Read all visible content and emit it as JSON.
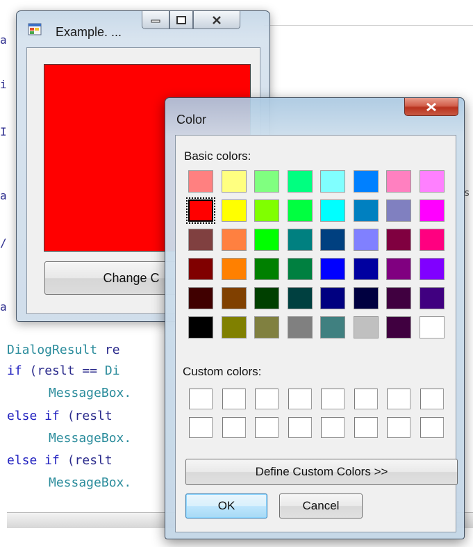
{
  "background_editor": {
    "code_lines": [
      {
        "parts": [
          {
            "t": "DialogResult ",
            "c": "type"
          },
          {
            "t": "re",
            "c": ""
          }
        ]
      },
      {
        "parts": [
          {
            "t": "if",
            "c": "kw"
          },
          {
            "t": " (reslt == ",
            "c": ""
          },
          {
            "t": "Di",
            "c": "type"
          }
        ]
      },
      {
        "indent": true,
        "parts": [
          {
            "t": "MessageBox.",
            "c": "type"
          }
        ]
      },
      {
        "parts": [
          {
            "t": "else if",
            "c": "kw"
          },
          {
            "t": " (reslt",
            "c": ""
          }
        ]
      },
      {
        "indent": true,
        "parts": [
          {
            "t": "MessageBox.",
            "c": "type"
          }
        ]
      },
      {
        "parts": [
          {
            "t": "else if",
            "c": "kw"
          },
          {
            "t": " (reslt",
            "c": ""
          }
        ]
      },
      {
        "indent": true,
        "parts": [
          {
            "t": "MessageBox.",
            "c": "type"
          }
        ]
      }
    ],
    "left_edge_fragments": [
      "a",
      "i",
      "I",
      "a",
      "/",
      "a"
    ]
  },
  "example_window": {
    "title": "Example. ...",
    "panel_color": "#ff0000",
    "change_button_label": "Change C"
  },
  "color_dialog": {
    "title": "Color",
    "basic_colors_label": "Basic colors:",
    "custom_colors_label": "Custom colors:",
    "basic_colors": [
      [
        "#ff8080",
        "#ffff80",
        "#80ff80",
        "#00ff80",
        "#80ffff",
        "#0080ff",
        "#ff80c0",
        "#ff80ff"
      ],
      [
        "#ff0000",
        "#ffff00",
        "#80ff00",
        "#00ff40",
        "#00ffff",
        "#0080c0",
        "#8080c0",
        "#ff00ff"
      ],
      [
        "#804040",
        "#ff8040",
        "#00ff00",
        "#008080",
        "#004080",
        "#8080ff",
        "#800040",
        "#ff0080"
      ],
      [
        "#800000",
        "#ff8000",
        "#008000",
        "#008040",
        "#0000ff",
        "#0000a0",
        "#800080",
        "#8000ff"
      ],
      [
        "#400000",
        "#804000",
        "#004000",
        "#004040",
        "#000080",
        "#000040",
        "#400040",
        "#400080"
      ],
      [
        "#000000",
        "#808000",
        "#808040",
        "#808080",
        "#408080",
        "#c0c0c0",
        "#400040",
        "#ffffff"
      ]
    ],
    "selected_basic_color": "#ff0000",
    "custom_colors": [
      [
        "#ffffff",
        "#ffffff",
        "#ffffff",
        "#ffffff",
        "#ffffff",
        "#ffffff",
        "#ffffff",
        "#ffffff"
      ],
      [
        "#ffffff",
        "#ffffff",
        "#ffffff",
        "#ffffff",
        "#ffffff",
        "#ffffff",
        "#ffffff",
        "#ffffff"
      ]
    ],
    "define_custom_label": "Define Custom Colors >>",
    "ok_label": "OK",
    "cancel_label": "Cancel"
  }
}
